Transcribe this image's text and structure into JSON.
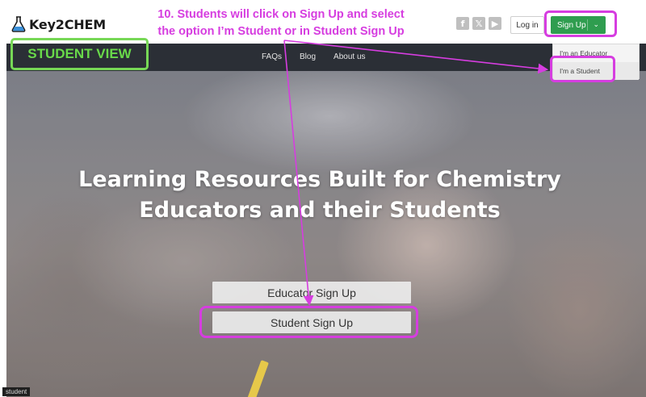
{
  "header": {
    "logo_text": "Key2CHEM",
    "logo_icon": "flask-icon",
    "instruction_line1": "10. Students will click on Sign Up and select",
    "instruction_line2": "the option I’m Student or in Student Sign Up",
    "social": [
      {
        "icon": "facebook-icon",
        "glyph": "f"
      },
      {
        "icon": "x-icon",
        "glyph": "𝕏"
      },
      {
        "icon": "youtube-icon",
        "glyph": "▶"
      }
    ],
    "login_label": "Log in",
    "signup_label": "Sign Up"
  },
  "annotation": {
    "student_view_label": "STUDENT VIEW",
    "accent_color": "#d63de0",
    "student_view_color": "#69d94a"
  },
  "nav": {
    "links": [
      "FAQs",
      "Blog",
      "About us"
    ]
  },
  "dropdown": {
    "items": [
      "I'm an Educator",
      "I'm a Student"
    ]
  },
  "hero": {
    "headline_line1": "Learning Resources Built for Chemistry",
    "headline_line2": "Educators and their Students",
    "educator_button": "Educator Sign Up",
    "student_button": "Student Sign Up"
  },
  "status": {
    "tooltip": "student"
  }
}
